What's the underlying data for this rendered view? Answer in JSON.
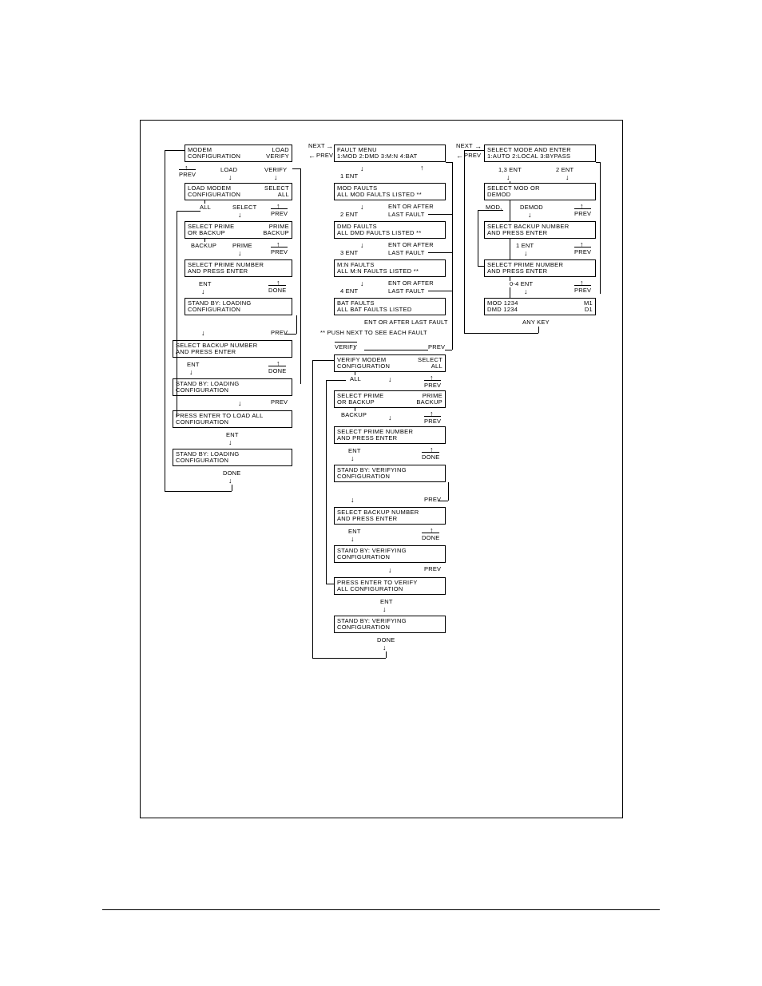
{
  "col1": {
    "b1": {
      "l1": "MODEM",
      "l2": "CONFIGURATION",
      "r1": "LOAD",
      "r2": "VERIFY"
    },
    "b1_nav": {
      "prev": "PREV",
      "load": "LOAD",
      "verify": "VERIFY"
    },
    "b2": {
      "l1": "LOAD  MODEM",
      "l2": "CONFIGURATION",
      "r1": "SELECT",
      "r2": "ALL"
    },
    "b2_nav": {
      "all": "ALL",
      "select": "SELECT",
      "prev": "PREV"
    },
    "b3": {
      "l1": "SELECT PRIME",
      "l2": "OR  BACKUP",
      "r1": "PRIME",
      "r2": "BACKUP"
    },
    "b3_nav": {
      "backup": "BACKUP",
      "prime": "PRIME",
      "prev": "PREV"
    },
    "b4": {
      "l1": "SELECT PRIME NUMBER",
      "l2": "AND  PRESS  ENTER"
    },
    "b4_nav": {
      "ent": "ENT",
      "done": "DONE"
    },
    "b5": {
      "l1": "STAND  BY:  LOADING",
      "l2": "CONFIGURATION"
    },
    "b5_nav": {
      "prev": "PREV"
    },
    "b6": {
      "l1": "SELECT  BACKUP  NUMBER",
      "l2": "AND  PRESS  ENTER"
    },
    "b6_nav": {
      "ent": "ENT",
      "done": "DONE"
    },
    "b7": {
      "l1": "STAND  BY:  LOADING",
      "l2": "CONFIGURATION"
    },
    "b7_nav": {
      "prev": "PREV"
    },
    "b8": {
      "l1": "PRESS  ENTER  TO  LOAD  ALL",
      "l2": "CONFIGURATION"
    },
    "b8_nav": {
      "ent": "ENT"
    },
    "b9": {
      "l1": "STAND  BY:  LOADING",
      "l2": "CONFIGURATION"
    },
    "b9_nav": {
      "done": "DONE"
    }
  },
  "col2": {
    "top_nav": {
      "next": "NEXT",
      "prev": "PREV"
    },
    "b1": {
      "l1": "FAULT  MENU",
      "l2": "1:MOD  2:DMD 3:M:N  4:BAT"
    },
    "e1": "1  ENT",
    "b2": {
      "l1": "MOD  FAULTS",
      "l2": "ALL  MOD  FAULTS  LISTED  **"
    },
    "e2a": "2  ENT",
    "e2b": "ENT OR AFTER",
    "e2c": "LAST FAULT",
    "b3": {
      "l1": "DMD  FAULTS",
      "l2": "ALL  DMD  FAULTS  LISTED  **"
    },
    "e3a": "3  ENT",
    "e3b": "ENT OR AFTER",
    "e3c": "LAST FAULT",
    "b4": {
      "l1": "M:N  FAULTS",
      "l2": "ALL  M:N  FAULTS  LISTED     **"
    },
    "e4a": "4  ENT",
    "e4b": "ENT OR AFTER",
    "e4c": "LAST FAULT",
    "b5": {
      "l1": "BAT FAULTS",
      "l2": "ALL  BAT  FAULTS  LISTED"
    },
    "e5": "ENT OR AFTER LAST FAULT",
    "note": "**  PUSH NEXT TO SEE EACH FAULT",
    "verify": "VERIFY",
    "prev": "PREV",
    "b6": {
      "l1": "VERIFY  MODEM",
      "l2": "CONFIGURATION",
      "r1": "SELECT",
      "r2": "ALL"
    },
    "b6_nav": {
      "all": "ALL",
      "prev": "PREV"
    },
    "b7": {
      "l1": "SELECT  PRIME",
      "l2": "OR  BACKUP",
      "r1": "PRIME",
      "r2": "BACKUP"
    },
    "b7_nav": {
      "backup": "BACKUP",
      "prev": "PREV"
    },
    "b8": {
      "l1": "SELECT  PRIME  NUMBER",
      "l2": "AND  PRESS  ENTER"
    },
    "b8_nav": {
      "ent": "ENT",
      "done": "DONE"
    },
    "b9": {
      "l1": "STAND BY:  VERIFYING",
      "l2": "CONFIGURATION"
    },
    "b9_nav": {
      "prev": "PREV"
    },
    "b10": {
      "l1": "SELECT  BACKUP  NUMBER",
      "l2": "AND  PRESS  ENTER"
    },
    "b10_nav": {
      "ent": "ENT",
      "done": "DONE"
    },
    "b11": {
      "l1": "STAND BY:  VERIFYING",
      "l2": "CONFIGURATION"
    },
    "b11_nav": {
      "prev": "PREV"
    },
    "b12": {
      "l1": "PRESS  ENTER  TO  VERIFY",
      "l2": "ALL  CONFIGURATION"
    },
    "b12_nav": {
      "ent": "ENT"
    },
    "b13": {
      "l1": "STAND BY:  VERIFYING",
      "l2": "CONFIGURATION"
    },
    "b13_nav": {
      "done": "DONE"
    }
  },
  "col3": {
    "top_nav": {
      "next": "NEXT",
      "prev": "PREV"
    },
    "b1": {
      "l1": "SELECT  MODE  AND  ENTER",
      "l2": "1:AUTO  2:LOCAL 3:BYPASS"
    },
    "b1_nav": {
      "left": "1,3  ENT",
      "right": "2  ENT"
    },
    "b2": {
      "l1": "SELECT  MOD  OR",
      "l2": "DEMOD"
    },
    "b2_nav": {
      "mod": "MOD,",
      "demod": "DEMOD",
      "prev": "PREV"
    },
    "b3": {
      "l1": "SELECT  BACKUP  NUMBER",
      "l2": "AND  PRESS  ENTER"
    },
    "b3_nav": {
      "ent": "1  ENT",
      "prev": "PREV"
    },
    "b4": {
      "l1": "SELECT PRIME NUMBER",
      "l2": "AND  PRESS  ENTER"
    },
    "b4_nav": {
      "ent": "0-4  ENT",
      "prev": "PREV"
    },
    "b5": {
      "l1": "MOD  1234",
      "l2": "DMD  1234",
      "r1": "M1",
      "r2": "D1"
    },
    "b5_nav": {
      "any": "ANY KEY"
    }
  }
}
